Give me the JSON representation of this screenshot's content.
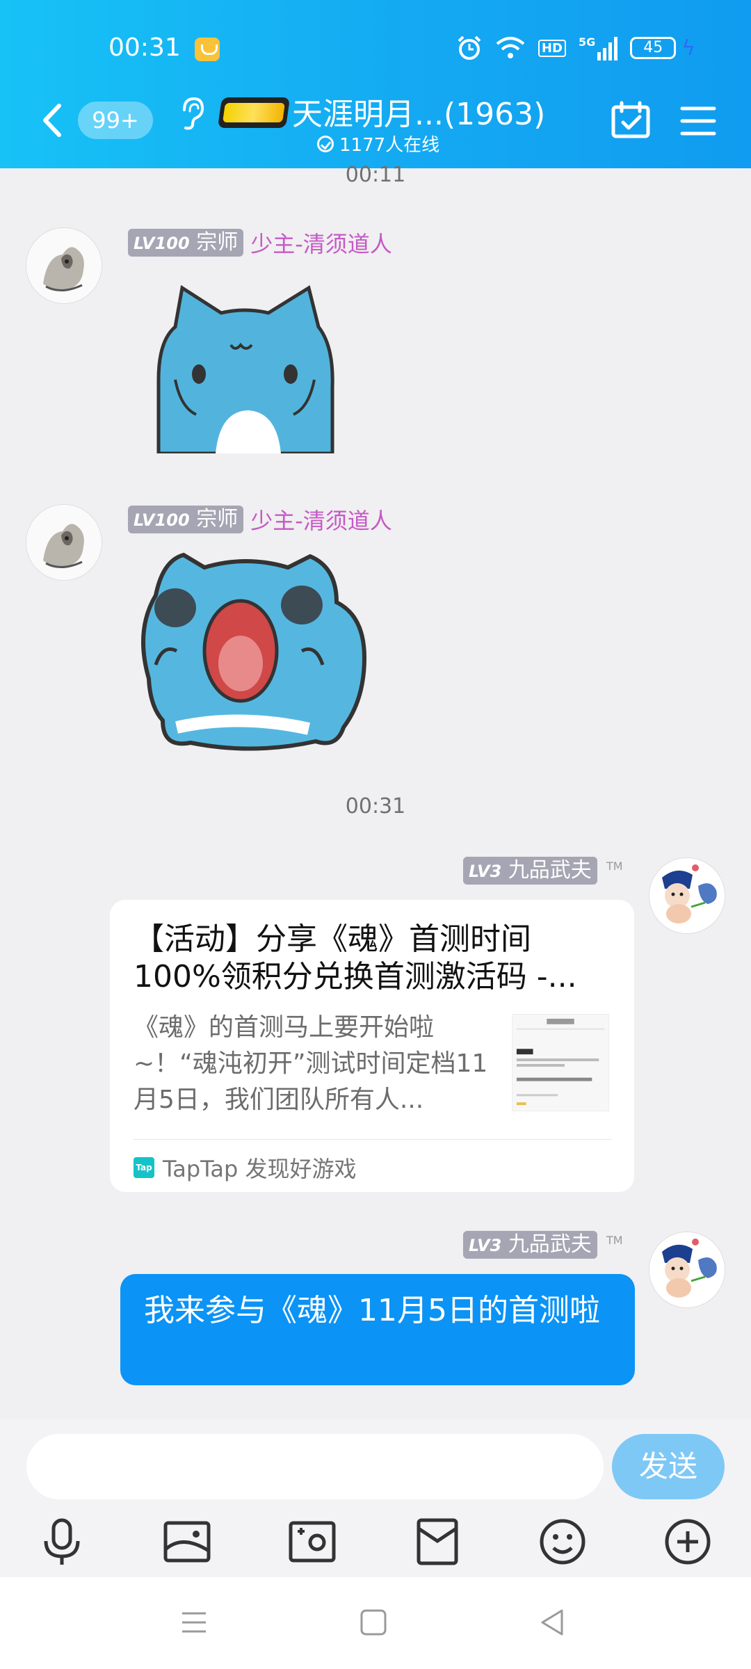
{
  "status": {
    "time": "00:31",
    "battery": "45",
    "network": "5G",
    "hd": "HD"
  },
  "header": {
    "unread_count": "99+",
    "group_title": "天涯明月...(1963)",
    "online_text": "1177人在线"
  },
  "messages": [
    {
      "time": "00:11"
    },
    {
      "sender_level": "LV100",
      "sender_rank": "宗师",
      "sender_name": "少主-清须道人",
      "type": "sticker",
      "sticker": "blue-cat-smile-sticker"
    },
    {
      "sender_level": "LV100",
      "sender_rank": "宗师",
      "sender_name": "少主-清须道人",
      "type": "sticker",
      "sticker": "blue-cat-shout-sticker"
    },
    {
      "time": "00:31"
    },
    {
      "sender_level": "LV3",
      "sender_rank": "九品武夫",
      "tm": "TM",
      "type": "link_card",
      "card_title": "【活动】分享《魂》首测时间100%领积分兑换首测激活码 -...",
      "card_desc": "《魂》的首测马上要开始啦~！“魂沌初开”测试时间定档11月5日，我们团队所有人...",
      "card_source": "TapTap 发现好游戏",
      "card_source_logo": "Tap"
    },
    {
      "sender_level": "LV3",
      "sender_rank": "九品武夫",
      "tm": "TM",
      "type": "text",
      "text": "我来参与《魂》11月5日的首测啦"
    }
  ],
  "input": {
    "placeholder": "",
    "value": "",
    "send_label": "发送"
  },
  "colors": {
    "header_start": "#17c2f6",
    "header_end": "#109cf0",
    "bubble_blue": "#0b93f6",
    "nick_pink": "#c659c6",
    "send_button": "#7ec8f6"
  }
}
